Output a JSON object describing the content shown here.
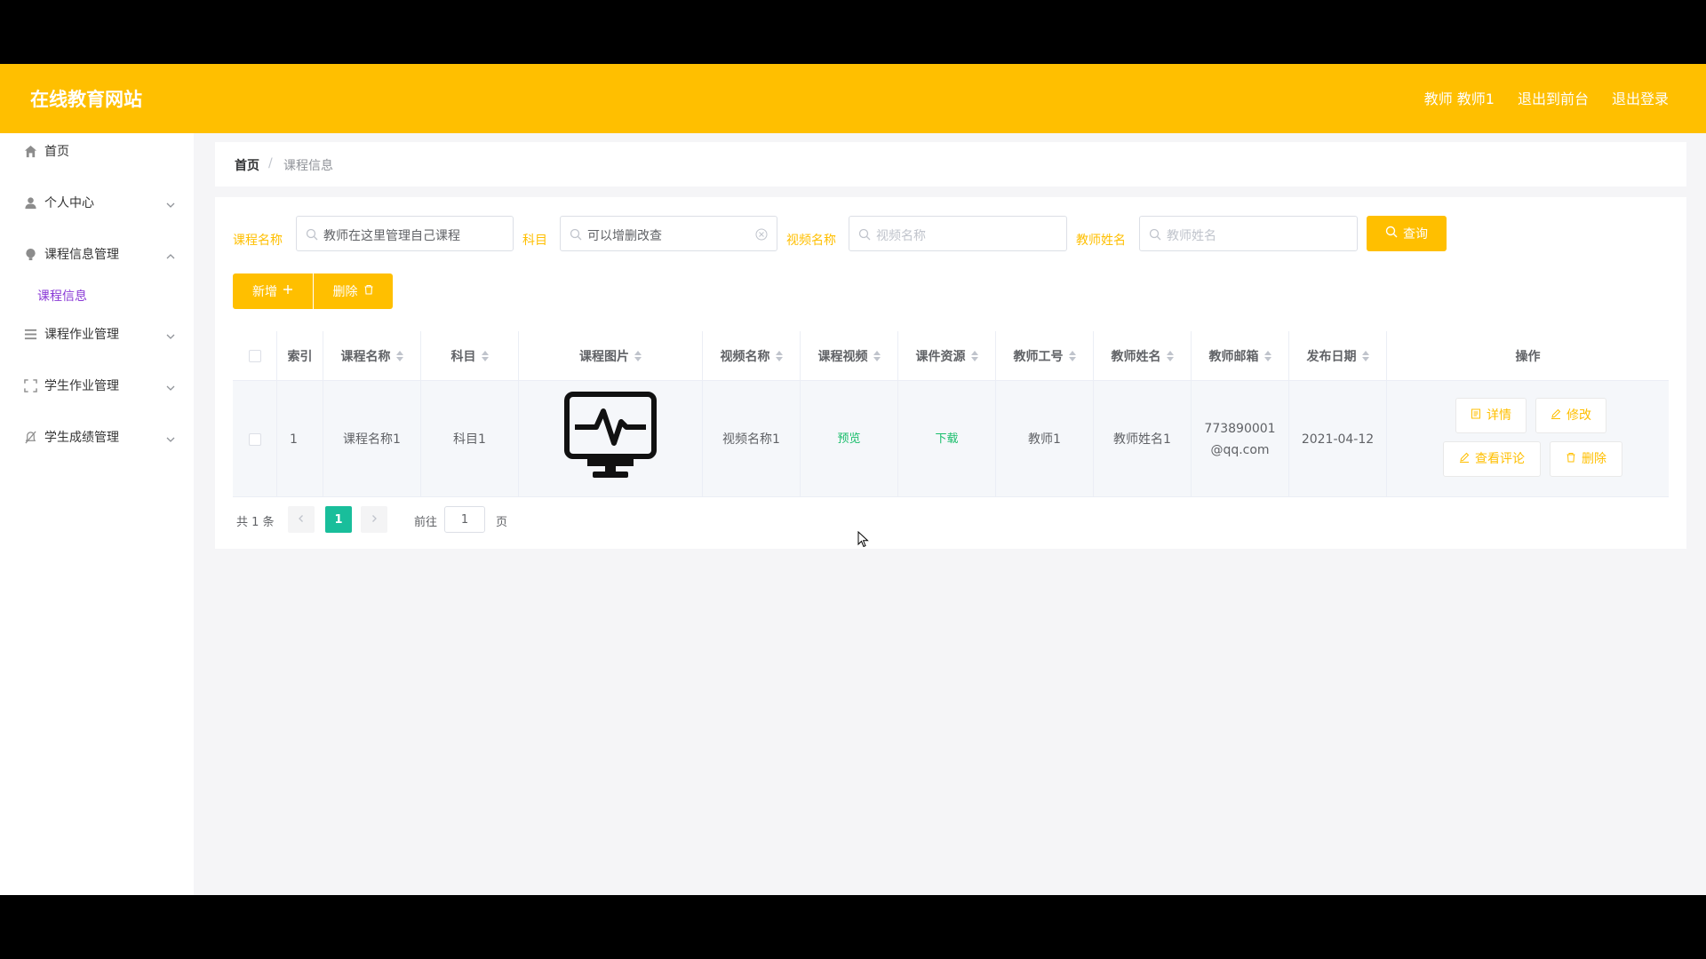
{
  "header": {
    "brand": "在线教育网站",
    "user": "教师 教师1",
    "back_to_front": "退出到前台",
    "logout": "退出登录"
  },
  "sidebar": {
    "items": [
      {
        "label": "首页",
        "icon": "home-icon"
      },
      {
        "label": "个人中心",
        "icon": "user-icon"
      },
      {
        "label": "课程信息管理",
        "icon": "bulb-icon"
      },
      {
        "label": "课程作业管理",
        "icon": "list-icon"
      },
      {
        "label": "学生作业管理",
        "icon": "fullscreen-icon"
      },
      {
        "label": "学生成绩管理",
        "icon": "bell-off-icon"
      }
    ],
    "sub_course_info": "课程信息"
  },
  "breadcrumb": {
    "home": "首页",
    "current": "课程信息",
    "separator": "/"
  },
  "filters": {
    "course_name": {
      "label": "课程名称",
      "value": "教师在这里管理自己课程"
    },
    "subject": {
      "label": "科目",
      "value": "可以增删改查"
    },
    "video_name": {
      "label": "视频名称",
      "placeholder": "视频名称"
    },
    "teacher_name": {
      "label": "教师姓名",
      "placeholder": "教师姓名"
    },
    "search_button": "查询"
  },
  "actions": {
    "add": "新增",
    "delete": "删除"
  },
  "table": {
    "headers": [
      "索引",
      "课程名称",
      "科目",
      "课程图片",
      "视频名称",
      "课程视频",
      "课件资源",
      "教师工号",
      "教师姓名",
      "教师邮箱",
      "发布日期",
      "操作"
    ],
    "rows": [
      {
        "index": "1",
        "course_name": "课程名称1",
        "subject": "科目1",
        "image_icon": "monitor-pulse-icon",
        "video_name": "视频名称1",
        "video_link": "预览",
        "resource_link": "下载",
        "teacher_id": "教师1",
        "teacher_name": "教师姓名1",
        "email_line1": "773890001",
        "email_line2": "@qq.com",
        "date": "2021-04-12",
        "ops": {
          "detail": "详情",
          "edit": "修改",
          "comments": "查看评论",
          "delete": "删除"
        }
      }
    ]
  },
  "pagination": {
    "total": "共 1 条",
    "current": "1",
    "goto_label": "前往",
    "goto_value": "1",
    "page_suffix": "页"
  },
  "colors": {
    "accent": "#ffbf00",
    "active_sub": "#8a3ad6",
    "link_green": "#19be6b",
    "page_active": "#19be9b"
  }
}
